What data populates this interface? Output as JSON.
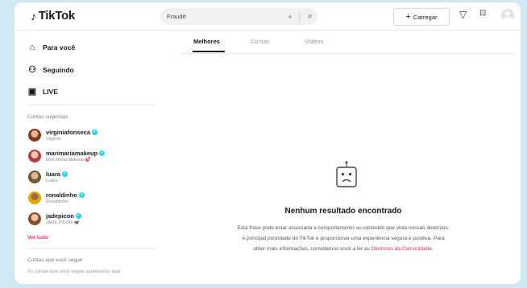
{
  "header": {
    "logo_text": "TikTok",
    "search_value": "Fraudé",
    "upload_label": "Carregar"
  },
  "sidebar": {
    "nav": [
      {
        "label": "Para você",
        "icon": "home-icon"
      },
      {
        "label": "Seguindo",
        "icon": "following-icon"
      },
      {
        "label": "LIVE",
        "icon": "live-icon"
      }
    ],
    "suggested_title": "Contas sugeridas",
    "accounts": [
      {
        "username": "virginiafonseca",
        "display": "Virginia",
        "extra": ""
      },
      {
        "username": "marimariamakeup",
        "display": "Mari Maria Makeup",
        "extra": "💕"
      },
      {
        "username": "luara",
        "display": "Luara",
        "extra": ""
      },
      {
        "username": "ronaldinho",
        "display": "Ronaldinho",
        "extra": ""
      },
      {
        "username": "jadepicon",
        "display": "JADE PICON",
        "extra": "🦋"
      }
    ],
    "see_all": "Ver tudo",
    "following_title": "Contas que você segue",
    "following_text": "As contas que você segue aparecerão aqui"
  },
  "tabs": [
    "Melhores",
    "Contas",
    "Vídeos"
  ],
  "empty": {
    "title": "Nenhum resultado encontrado",
    "text": "Esta frase pode estar associada a comportamento ou conteúdo que viola nossas diretrizes. A principal prioridade do TikTok é proporcionar uma experiência segura e positiva. Para obter mais informações, convidamos você a ler as ",
    "link": "Diretrizes da Comunidade",
    "end": "."
  },
  "colors": {
    "accent": "#fe2c55",
    "verified": "#20d5ec"
  }
}
